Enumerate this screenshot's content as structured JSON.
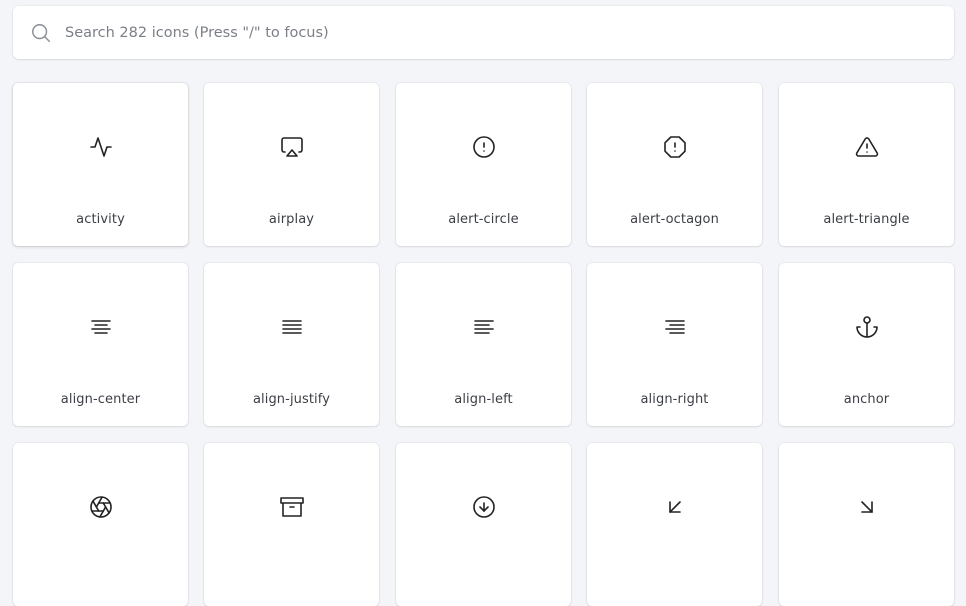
{
  "search": {
    "placeholder": "Search 282 icons (Press \"/\" to focus)",
    "value": "",
    "icon": "search-icon"
  },
  "icons": [
    {
      "label": "activity",
      "icon": "activity-icon"
    },
    {
      "label": "airplay",
      "icon": "airplay-icon"
    },
    {
      "label": "alert-circle",
      "icon": "alert-circle-icon"
    },
    {
      "label": "alert-octagon",
      "icon": "alert-octagon-icon"
    },
    {
      "label": "alert-triangle",
      "icon": "alert-triangle-icon"
    },
    {
      "label": "align-center",
      "icon": "align-center-icon"
    },
    {
      "label": "align-justify",
      "icon": "align-justify-icon"
    },
    {
      "label": "align-left",
      "icon": "align-left-icon"
    },
    {
      "label": "align-right",
      "icon": "align-right-icon"
    },
    {
      "label": "anchor",
      "icon": "anchor-icon"
    },
    {
      "label": "",
      "icon": "aperture-icon"
    },
    {
      "label": "",
      "icon": "archive-icon"
    },
    {
      "label": "",
      "icon": "arrow-down-circle-icon"
    },
    {
      "label": "",
      "icon": "arrow-down-left-icon"
    },
    {
      "label": "",
      "icon": "arrow-down-right-icon"
    }
  ]
}
